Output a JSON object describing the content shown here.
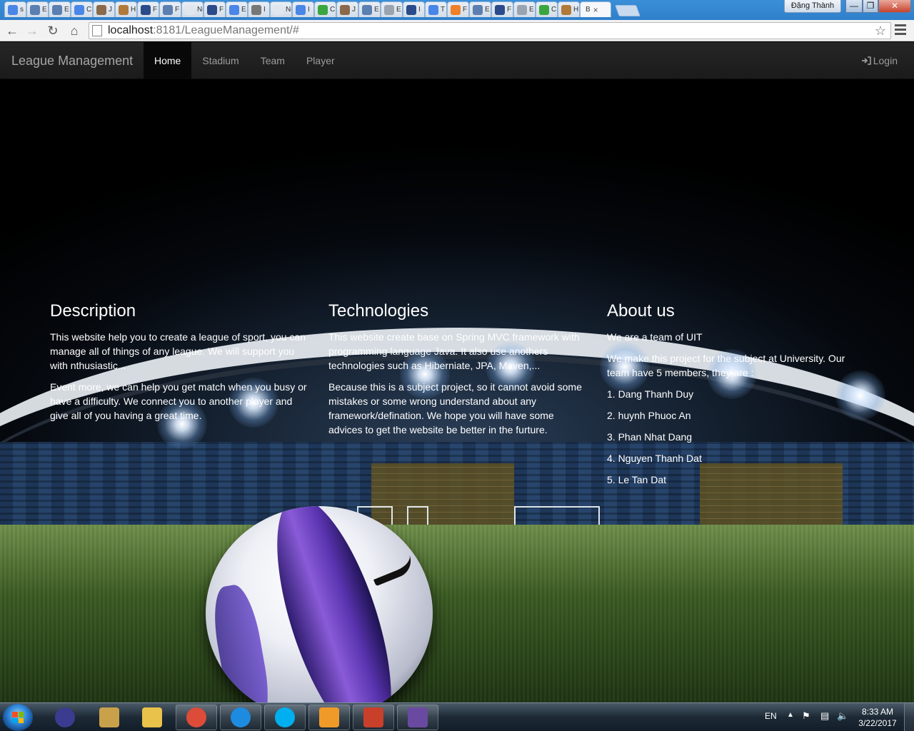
{
  "browser": {
    "tabs": [
      {
        "label": "s",
        "fav": "#4a86e8"
      },
      {
        "label": "E",
        "fav": "#5b7fb0"
      },
      {
        "label": "E",
        "fav": "#5b7fb0"
      },
      {
        "label": "C",
        "fav": "#4a86e8"
      },
      {
        "label": "J",
        "fav": "#8a6a4a"
      },
      {
        "label": "H",
        "fav": "#b07a3a"
      },
      {
        "label": "F",
        "fav": "#2a4a8a"
      },
      {
        "label": "F",
        "fav": "#5b7fb0"
      },
      {
        "label": "New",
        "fav": "#e0e6ee"
      },
      {
        "label": "F",
        "fav": "#2a4a8a"
      },
      {
        "label": "E",
        "fav": "#4a86e8"
      },
      {
        "label": "I",
        "fav": "#777777"
      },
      {
        "label": "New",
        "fav": "#e0e6ee"
      },
      {
        "label": "I",
        "fav": "#4a86e8"
      },
      {
        "label": "C",
        "fav": "#3aa640"
      },
      {
        "label": "J",
        "fav": "#8a6a4a"
      },
      {
        "label": "E",
        "fav": "#5b7fb0"
      },
      {
        "label": "E",
        "fav": "#9aa4b0"
      },
      {
        "label": "I",
        "fav": "#2a4a8a"
      },
      {
        "label": "T",
        "fav": "#4a86e8"
      },
      {
        "label": "F",
        "fav": "#f0802a"
      },
      {
        "label": "E",
        "fav": "#5b7fb0"
      },
      {
        "label": "F",
        "fav": "#2a4a8a"
      },
      {
        "label": "E",
        "fav": "#9aa4b0"
      },
      {
        "label": "C",
        "fav": "#3aa640"
      },
      {
        "label": "H",
        "fav": "#b07a3a"
      }
    ],
    "active_tab": {
      "label": "B",
      "close": "×"
    },
    "user_button": "Đặng Thành",
    "window_controls": {
      "minimize": "—",
      "maximize": "❐",
      "close": "✕"
    },
    "url_host": "localhost",
    "url_path": ":8181/LeagueManagement/#"
  },
  "navbar": {
    "brand": "League Management",
    "items": [
      "Home",
      "Stadium",
      "Team",
      "Player"
    ],
    "active_index": 0,
    "login": "Login"
  },
  "columns": {
    "description": {
      "title": "Description",
      "p1": "This website help you to create a league of sport, you can manage all of things of any league. We will support you with nthusiastic...",
      "p2": "Event more, we can help you get match when you busy or have a difficulty. We connect you to another player and give all of you having a great time."
    },
    "technologies": {
      "title": "Technologies",
      "p1": "This website create base on Spring MVC framework with programming language Java. It also use anothers technologies such as Hiberniate, JPA, Maven,...",
      "p2": "Because this is a subject project, so it cannot avoid some mistakes or some wrong understand about any framework/defination. We hope you will have some advices to get the website be better in the furture."
    },
    "about": {
      "title": "About us",
      "p1": "We are a team of UIT",
      "p2": "We make this project for the subject at University. Our team have 5 members, they are :",
      "members": [
        "1. Dang Thanh Duy",
        "2. huynh Phuoc An",
        "3. Phan Nhat Dang",
        "4. Nguyen Thanh Dat",
        "5. Le Tan Dat"
      ]
    }
  },
  "taskbar": {
    "apps": [
      {
        "name": "eclipse",
        "color": "#3b3c8f"
      },
      {
        "name": "tools",
        "color": "#c9a14a"
      },
      {
        "name": "file-explorer",
        "color": "#e8c24a"
      },
      {
        "name": "chrome",
        "color": "#dd4b39"
      },
      {
        "name": "skype-business",
        "color": "#1d8ce0"
      },
      {
        "name": "skype",
        "color": "#00aff0"
      },
      {
        "name": "outlook",
        "color": "#f09a2a"
      },
      {
        "name": "volume",
        "color": "#c8402a"
      },
      {
        "name": "java-ee-ide",
        "color": "#6a4aa0"
      }
    ],
    "language": "EN",
    "time": "8:33 AM",
    "date": "3/22/2017"
  }
}
